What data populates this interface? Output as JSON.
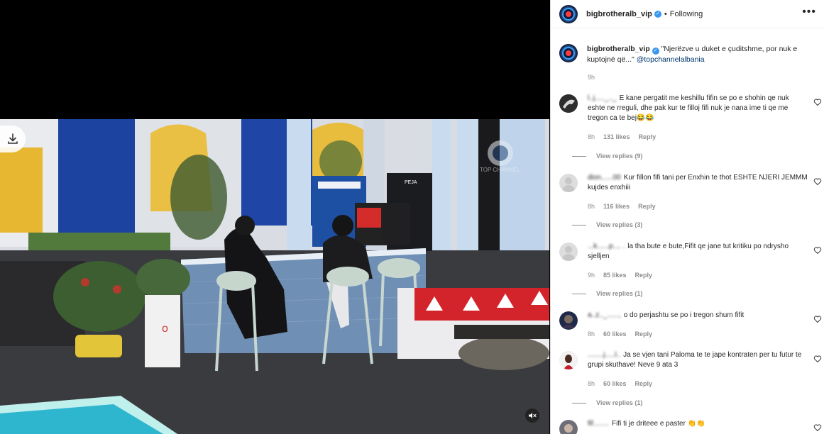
{
  "post": {
    "username": "bigbrotheralb_vip",
    "follow_state": "Following",
    "separator": "•",
    "more_icon": "more-horizontal-icon"
  },
  "media": {
    "watermark": "TOP CHANNEL",
    "fridge_label": "PEJA",
    "download_icon": "download-icon",
    "mute_icon": "speaker-muted-icon"
  },
  "caption": {
    "username": "bigbrotheralb_vip",
    "text": "\"Njerëzve u duket e çuditshme, por nuk e kuptojnë që...\"",
    "mention": "@topchannelalbania",
    "time": "9h"
  },
  "comments": [
    {
      "author": "l..j....._.._",
      "text": "E kane pergatit me keshillu fifin se po e shohin qe nuk eshte ne rreguli, dhe pak kur te filloj fifi nuk je nana ime ti qe me tregon ca te bej😂😂",
      "time": "8h",
      "likes": "131 likes",
      "reply": "Reply",
      "view_replies": "View replies (9)"
    },
    {
      "author": "dion......00",
      "text": "Kur fillon fifi tani per Enxhin te thot ESHTE NJERI JEMMM kujdes enxhiii",
      "time": "8h",
      "likes": "116 likes",
      "reply": "Reply",
      "view_replies": "View replies (3)"
    },
    {
      "author": "...k......p.... .",
      "text": "la tha bute e bute,Fifit qe jane tut kritiku po ndrysho sjelljen",
      "time": "9h",
      "likes": "85 likes",
      "reply": "Reply",
      "view_replies": "View replies (1)"
    },
    {
      "author": "a..z.._......,",
      "text": "o do perjashtu se po i tregon shum fifit",
      "time": "8h",
      "likes": "60 likes",
      "reply": "Reply",
      "view_replies": ""
    },
    {
      "author": "........j.....l..",
      "text": "Ja se vjen tani Paloma te te jape kontraten per tu futur te grupi skuthave! Neve 9 ata 3",
      "time": "8h",
      "likes": "60 likes",
      "reply": "Reply",
      "view_replies": "View replies (1)"
    },
    {
      "author": "fif........",
      "text": "Fifi ti je driteee e paster 👏👏",
      "time": "",
      "likes": "",
      "reply": "",
      "view_replies": ""
    }
  ],
  "colors": {
    "link": "#00376b",
    "verified": "#3897f0",
    "muted_text": "#8e8e8e"
  }
}
